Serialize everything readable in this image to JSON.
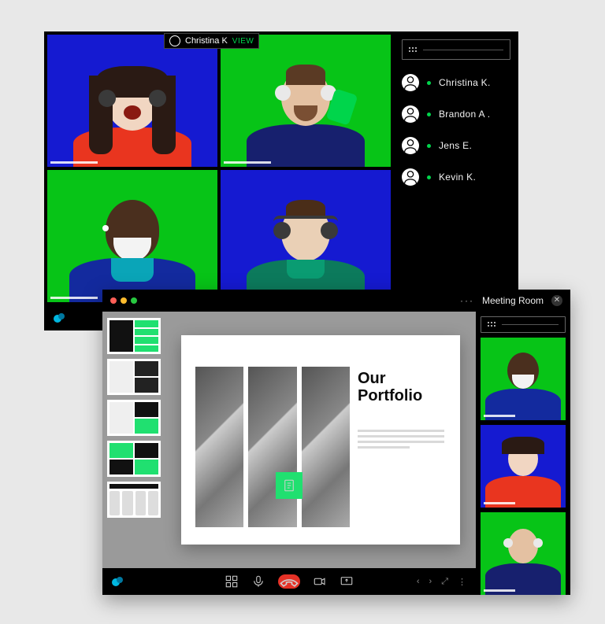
{
  "colors": {
    "blue": "#151ad1",
    "green": "#07c417",
    "accent": "#00d54b"
  },
  "win1": {
    "overlay": {
      "name": "Christina K",
      "view_label": "VIEW"
    },
    "participants": [
      {
        "name": "Christina K."
      },
      {
        "name": "Brandon A ."
      },
      {
        "name": "Jens E."
      },
      {
        "name": "Kevin K."
      }
    ]
  },
  "win2": {
    "title": "Meeting Room",
    "slide": {
      "title": "Our Portfolio"
    }
  }
}
